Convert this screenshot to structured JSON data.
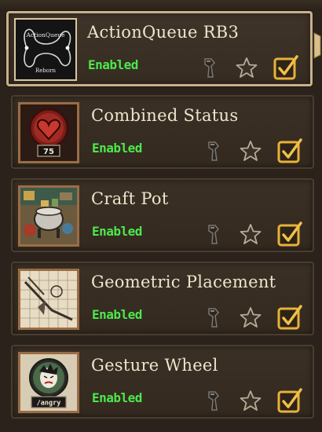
{
  "mods": [
    {
      "title": "ActionQueue RB3",
      "status": "Enabled",
      "selected": true,
      "thumb_text_top": "ActionQueue",
      "thumb_text_bottom": "Reborn"
    },
    {
      "title": "Combined Status",
      "status": "Enabled",
      "selected": false,
      "thumb_value": "75"
    },
    {
      "title": "Craft Pot",
      "status": "Enabled",
      "selected": false
    },
    {
      "title": "Geometric Placement",
      "status": "Enabled",
      "selected": false
    },
    {
      "title": "Gesture Wheel",
      "status": "Enabled",
      "selected": false,
      "thumb_text": "/angry"
    }
  ],
  "icons": {
    "config": "wrench-icon",
    "favorite": "star-icon",
    "toggle": "checkbox-checked-icon"
  },
  "colors": {
    "status_enabled": "#4ce84c",
    "title": "#efe4cc",
    "selected_border": "#c7b189",
    "checkbox": "#e8b23a"
  }
}
